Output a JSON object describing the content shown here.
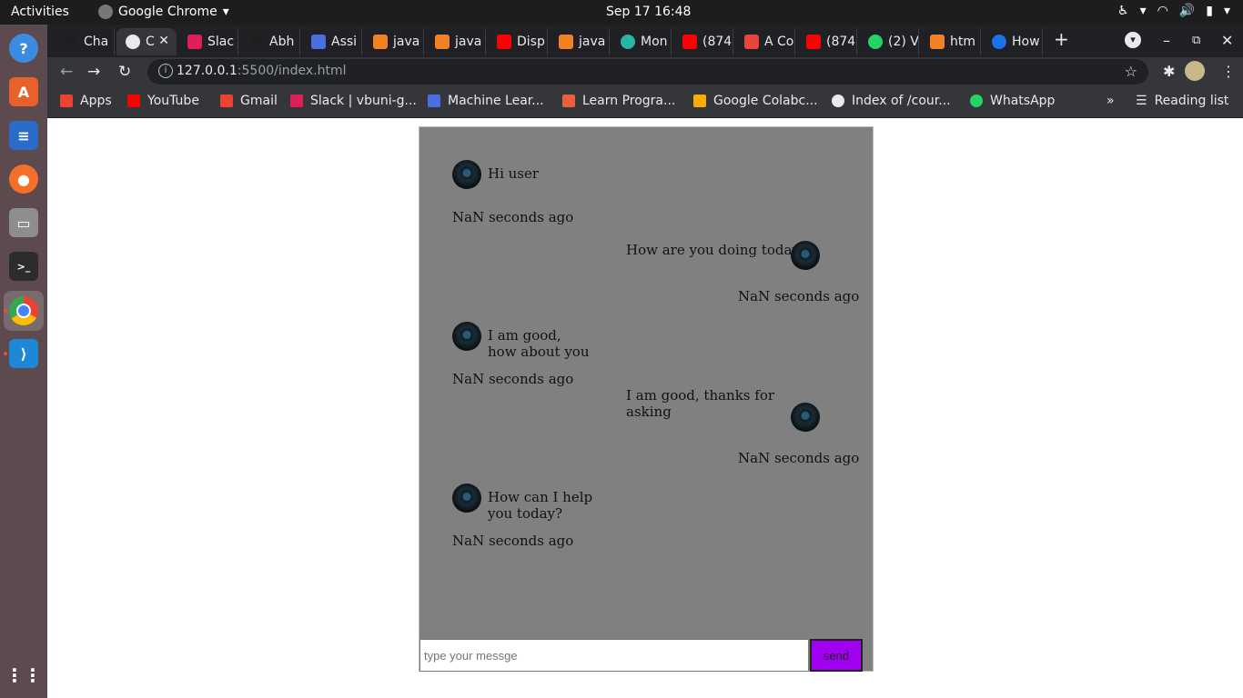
{
  "system": {
    "activities": "Activities",
    "app_name": "Google Chrome",
    "clock": "Sep 17  16:48"
  },
  "tabs": [
    {
      "label": "Cha",
      "icon": "github-icon",
      "color": "#1f1f1f"
    },
    {
      "label": "C",
      "icon": "globe-icon",
      "color": "#e8eaed",
      "active": true
    },
    {
      "label": "Slac",
      "icon": "slack-icon",
      "color": "#e01e5a"
    },
    {
      "label": "Abh",
      "icon": "github-icon",
      "color": "#1f1f1f"
    },
    {
      "label": "Assi",
      "icon": "docs-icon",
      "color": "#4a6fe3"
    },
    {
      "label": "java",
      "icon": "stackoverflow-icon",
      "color": "#f48024"
    },
    {
      "label": "java",
      "icon": "stackoverflow-icon",
      "color": "#f48024"
    },
    {
      "label": "Disp",
      "icon": "youtube-icon",
      "color": "#ff0000"
    },
    {
      "label": "java",
      "icon": "stackoverflow-icon",
      "color": "#f48024"
    },
    {
      "label": "Mon",
      "icon": "clock-icon",
      "color": "#2bb5a5"
    },
    {
      "label": "(874",
      "icon": "youtube-icon",
      "color": "#ff0000"
    },
    {
      "label": "A Co",
      "icon": "asterisk-icon",
      "color": "#e8453c"
    },
    {
      "label": "(874",
      "icon": "youtube-icon",
      "color": "#ff0000"
    },
    {
      "label": "(2) V",
      "icon": "whatsapp-icon",
      "color": "#25d366"
    },
    {
      "label": "htm",
      "icon": "stackoverflow-icon",
      "color": "#f48024"
    },
    {
      "label": "How",
      "icon": "loader-icon",
      "color": "#1a73e8"
    }
  ],
  "toolbar": {
    "url_host": "127.0.0.1",
    "url_path": ":5500/index.html"
  },
  "bookmarks": [
    {
      "label": "Apps",
      "icon": "apps-grid-icon",
      "color": "#ea4335"
    },
    {
      "label": "YouTube",
      "icon": "youtube-icon",
      "color": "#ff0000"
    },
    {
      "label": "Gmail",
      "icon": "gmail-icon",
      "color": "#ea4335"
    },
    {
      "label": "Slack | vbuni-g...",
      "icon": "slack-icon",
      "color": "#e01e5a"
    },
    {
      "label": "Machine Lear...",
      "icon": "classroom-icon",
      "color": "#4a6fe3"
    },
    {
      "label": "Learn Progra...",
      "icon": "codecademy-icon",
      "color": "#e8613c"
    },
    {
      "label": "Google Colabc...",
      "icon": "colab-icon",
      "color": "#f9ab00"
    },
    {
      "label": "Index of /cour...",
      "icon": "globe-icon",
      "color": "#e8eaed"
    },
    {
      "label": "WhatsApp",
      "icon": "whatsapp-icon",
      "color": "#25d366"
    }
  ],
  "bookmarks_overflow": "»",
  "reading_list": "Reading list",
  "chat": {
    "messages": [
      {
        "side": "left",
        "text": "Hi user",
        "time": "NaN seconds ago"
      },
      {
        "side": "right",
        "text": "How are you doing today",
        "time": "NaN seconds ago"
      },
      {
        "side": "left",
        "text_line1": "I am good,",
        "text_line2": "how about you",
        "time": "NaN seconds ago"
      },
      {
        "side": "right",
        "text_line1": "I am good, thanks for",
        "text_line2": "asking",
        "time": "NaN seconds ago"
      },
      {
        "side": "left",
        "text_line1": "How can I help",
        "text_line2": "you today?",
        "time": "NaN seconds ago"
      }
    ],
    "input_placeholder": "type your messge",
    "send_label": "send",
    "accent_color": "#a100f2",
    "panel_color": "#808080"
  }
}
